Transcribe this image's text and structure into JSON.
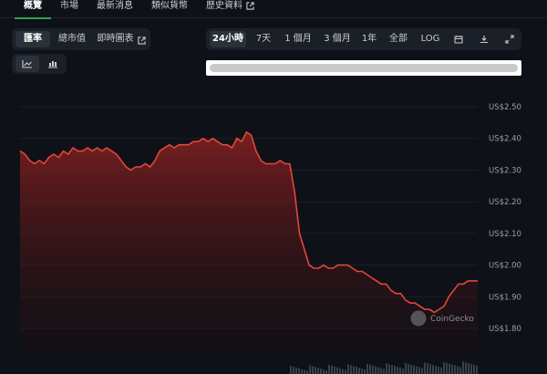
{
  "top_tabs": [
    {
      "label": "概覽",
      "active": true
    },
    {
      "label": "市場",
      "active": false
    },
    {
      "label": "最新消息",
      "active": false
    },
    {
      "label": "類似貨幣",
      "active": false
    },
    {
      "label": "歷史資料",
      "active": false,
      "external": true
    }
  ],
  "chart_type_tabs": [
    {
      "label": "匯率",
      "active": true
    },
    {
      "label": "總市值",
      "active": false
    },
    {
      "label": "即時圖表",
      "active": false,
      "external": true
    }
  ],
  "chart_style_buttons": [
    {
      "icon": "line-chart-icon",
      "active": true
    },
    {
      "icon": "candlestick-icon",
      "active": false
    }
  ],
  "ranges": [
    {
      "label": "24小時",
      "active": true
    },
    {
      "label": "7天",
      "active": false
    },
    {
      "label": "1 個月",
      "active": false
    },
    {
      "label": "3 個月",
      "active": false
    },
    {
      "label": "1年",
      "active": false
    },
    {
      "label": "全部",
      "active": false
    },
    {
      "label": "LOG",
      "active": false
    }
  ],
  "range_icons": [
    "calendar-icon",
    "download-icon",
    "expand-icon"
  ],
  "watermark": "CoinGecko",
  "colors": {
    "accent": "#2fa14f",
    "line": "#e5453c",
    "area": "#7a1f1f"
  },
  "chart_data": {
    "type": "area",
    "yticks": [
      "US$2.50",
      "US$2.40",
      "US$2.30",
      "US$2.20",
      "US$2.10",
      "US$2.00",
      "US$1.90",
      "US$1.80"
    ],
    "ylim": [
      1.8,
      2.5
    ],
    "series": [
      {
        "values": [
          2.36,
          2.35,
          2.33,
          2.32,
          2.33,
          2.32,
          2.34,
          2.35,
          2.34,
          2.36,
          2.35,
          2.37,
          2.36,
          2.36,
          2.37,
          2.36,
          2.37,
          2.36,
          2.37,
          2.36,
          2.35,
          2.33,
          2.31,
          2.3,
          2.31,
          2.31,
          2.32,
          2.31,
          2.33,
          2.36,
          2.37,
          2.38,
          2.37,
          2.38,
          2.38,
          2.38,
          2.39,
          2.39,
          2.4,
          2.39,
          2.4,
          2.39,
          2.38,
          2.38,
          2.37,
          2.4,
          2.39,
          2.42,
          2.41,
          2.36,
          2.33,
          2.32,
          2.32,
          2.32,
          2.33,
          2.32,
          2.32,
          2.23,
          2.1,
          2.05,
          2.0,
          1.99,
          1.99,
          2.0,
          1.99,
          1.99,
          2.0,
          2.0,
          2.0,
          1.99,
          1.98,
          1.98,
          1.97,
          1.96,
          1.95,
          1.94,
          1.94,
          1.92,
          1.91,
          1.91,
          1.89,
          1.88,
          1.88,
          1.87,
          1.86,
          1.86,
          1.85,
          1.86,
          1.87,
          1.9,
          1.92,
          1.94,
          1.94,
          1.95,
          1.95,
          1.95
        ]
      }
    ]
  }
}
